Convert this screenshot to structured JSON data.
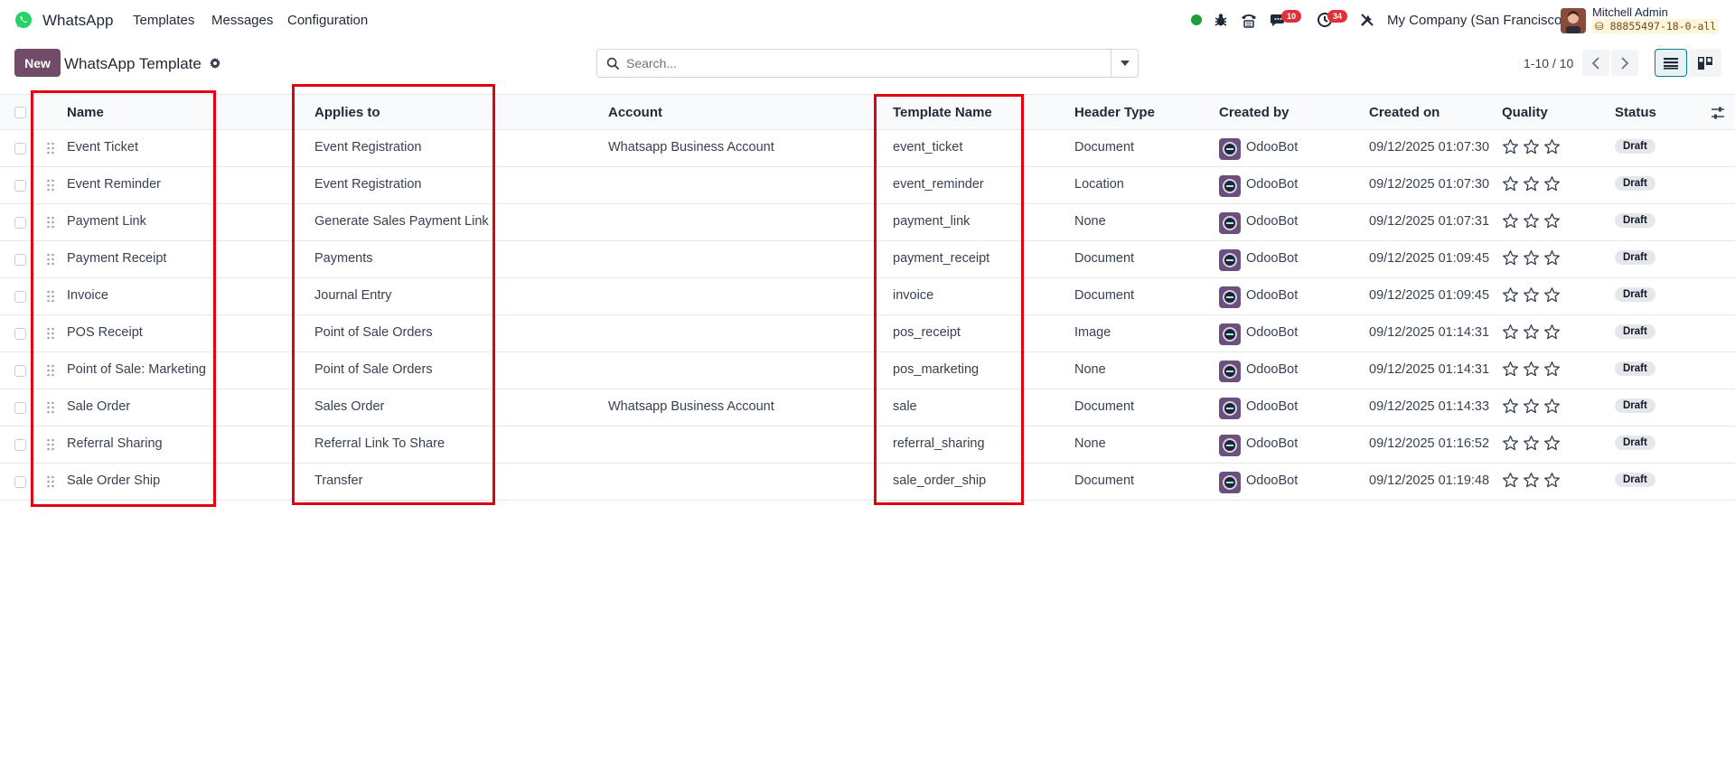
{
  "app": {
    "name": "WhatsApp",
    "menu": [
      "Templates",
      "Messages",
      "Configuration"
    ],
    "colors": {
      "brand": "#714b67",
      "whatsapp": "#25d366",
      "badge": "#e0313b",
      "highlight": "#e3000f"
    }
  },
  "systray": {
    "messages_badge": "10",
    "activities_badge": "34",
    "company": "My Company (San Francisco)",
    "user_name": "Mitchell Admin",
    "db_name": "88855497-18-0-all"
  },
  "control": {
    "new_label": "New",
    "title": "WhatsApp Template",
    "search_placeholder": "Search...",
    "pager": "1-10 / 10"
  },
  "table": {
    "columns": {
      "name": "Name",
      "applies_to": "Applies to",
      "account": "Account",
      "template_name": "Template Name",
      "header_type": "Header Type",
      "created_by": "Created by",
      "created_on": "Created on",
      "quality": "Quality",
      "status": "Status"
    },
    "rows": [
      {
        "name": "Event Ticket",
        "applies_to": "Event Registration",
        "account": "Whatsapp Business Account",
        "template_name": "event_ticket",
        "header_type": "Document",
        "created_by": "OdooBot",
        "created_on": "09/12/2025 01:07:30",
        "quality_stars": 0,
        "status": "Draft"
      },
      {
        "name": "Event Reminder",
        "applies_to": "Event Registration",
        "account": "",
        "template_name": "event_reminder",
        "header_type": "Location",
        "created_by": "OdooBot",
        "created_on": "09/12/2025 01:07:30",
        "quality_stars": 0,
        "status": "Draft"
      },
      {
        "name": "Payment Link",
        "applies_to": "Generate Sales Payment Link",
        "account": "",
        "template_name": "payment_link",
        "header_type": "None",
        "created_by": "OdooBot",
        "created_on": "09/12/2025 01:07:31",
        "quality_stars": 0,
        "status": "Draft"
      },
      {
        "name": "Payment Receipt",
        "applies_to": "Payments",
        "account": "",
        "template_name": "payment_receipt",
        "header_type": "Document",
        "created_by": "OdooBot",
        "created_on": "09/12/2025 01:09:45",
        "quality_stars": 0,
        "status": "Draft"
      },
      {
        "name": "Invoice",
        "applies_to": "Journal Entry",
        "account": "",
        "template_name": "invoice",
        "header_type": "Document",
        "created_by": "OdooBot",
        "created_on": "09/12/2025 01:09:45",
        "quality_stars": 0,
        "status": "Draft"
      },
      {
        "name": "POS Receipt",
        "applies_to": "Point of Sale Orders",
        "account": "",
        "template_name": "pos_receipt",
        "header_type": "Image",
        "created_by": "OdooBot",
        "created_on": "09/12/2025 01:14:31",
        "quality_stars": 0,
        "status": "Draft"
      },
      {
        "name": "Point of Sale: Marketing",
        "applies_to": "Point of Sale Orders",
        "account": "",
        "template_name": "pos_marketing",
        "header_type": "None",
        "created_by": "OdooBot",
        "created_on": "09/12/2025 01:14:31",
        "quality_stars": 0,
        "status": "Draft"
      },
      {
        "name": "Sale Order",
        "applies_to": "Sales Order",
        "account": "Whatsapp Business Account",
        "template_name": "sale",
        "header_type": "Document",
        "created_by": "OdooBot",
        "created_on": "09/12/2025 01:14:33",
        "quality_stars": 0,
        "status": "Draft"
      },
      {
        "name": "Referral Sharing",
        "applies_to": "Referral Link To Share",
        "account": "",
        "template_name": "referral_sharing",
        "header_type": "None",
        "created_by": "OdooBot",
        "created_on": "09/12/2025 01:16:52",
        "quality_stars": 0,
        "status": "Draft"
      },
      {
        "name": "Sale Order Ship",
        "applies_to": "Transfer",
        "account": "",
        "template_name": "sale_order_ship",
        "header_type": "Document",
        "created_by": "OdooBot",
        "created_on": "09/12/2025 01:19:48",
        "quality_stars": 0,
        "status": "Draft"
      }
    ]
  }
}
